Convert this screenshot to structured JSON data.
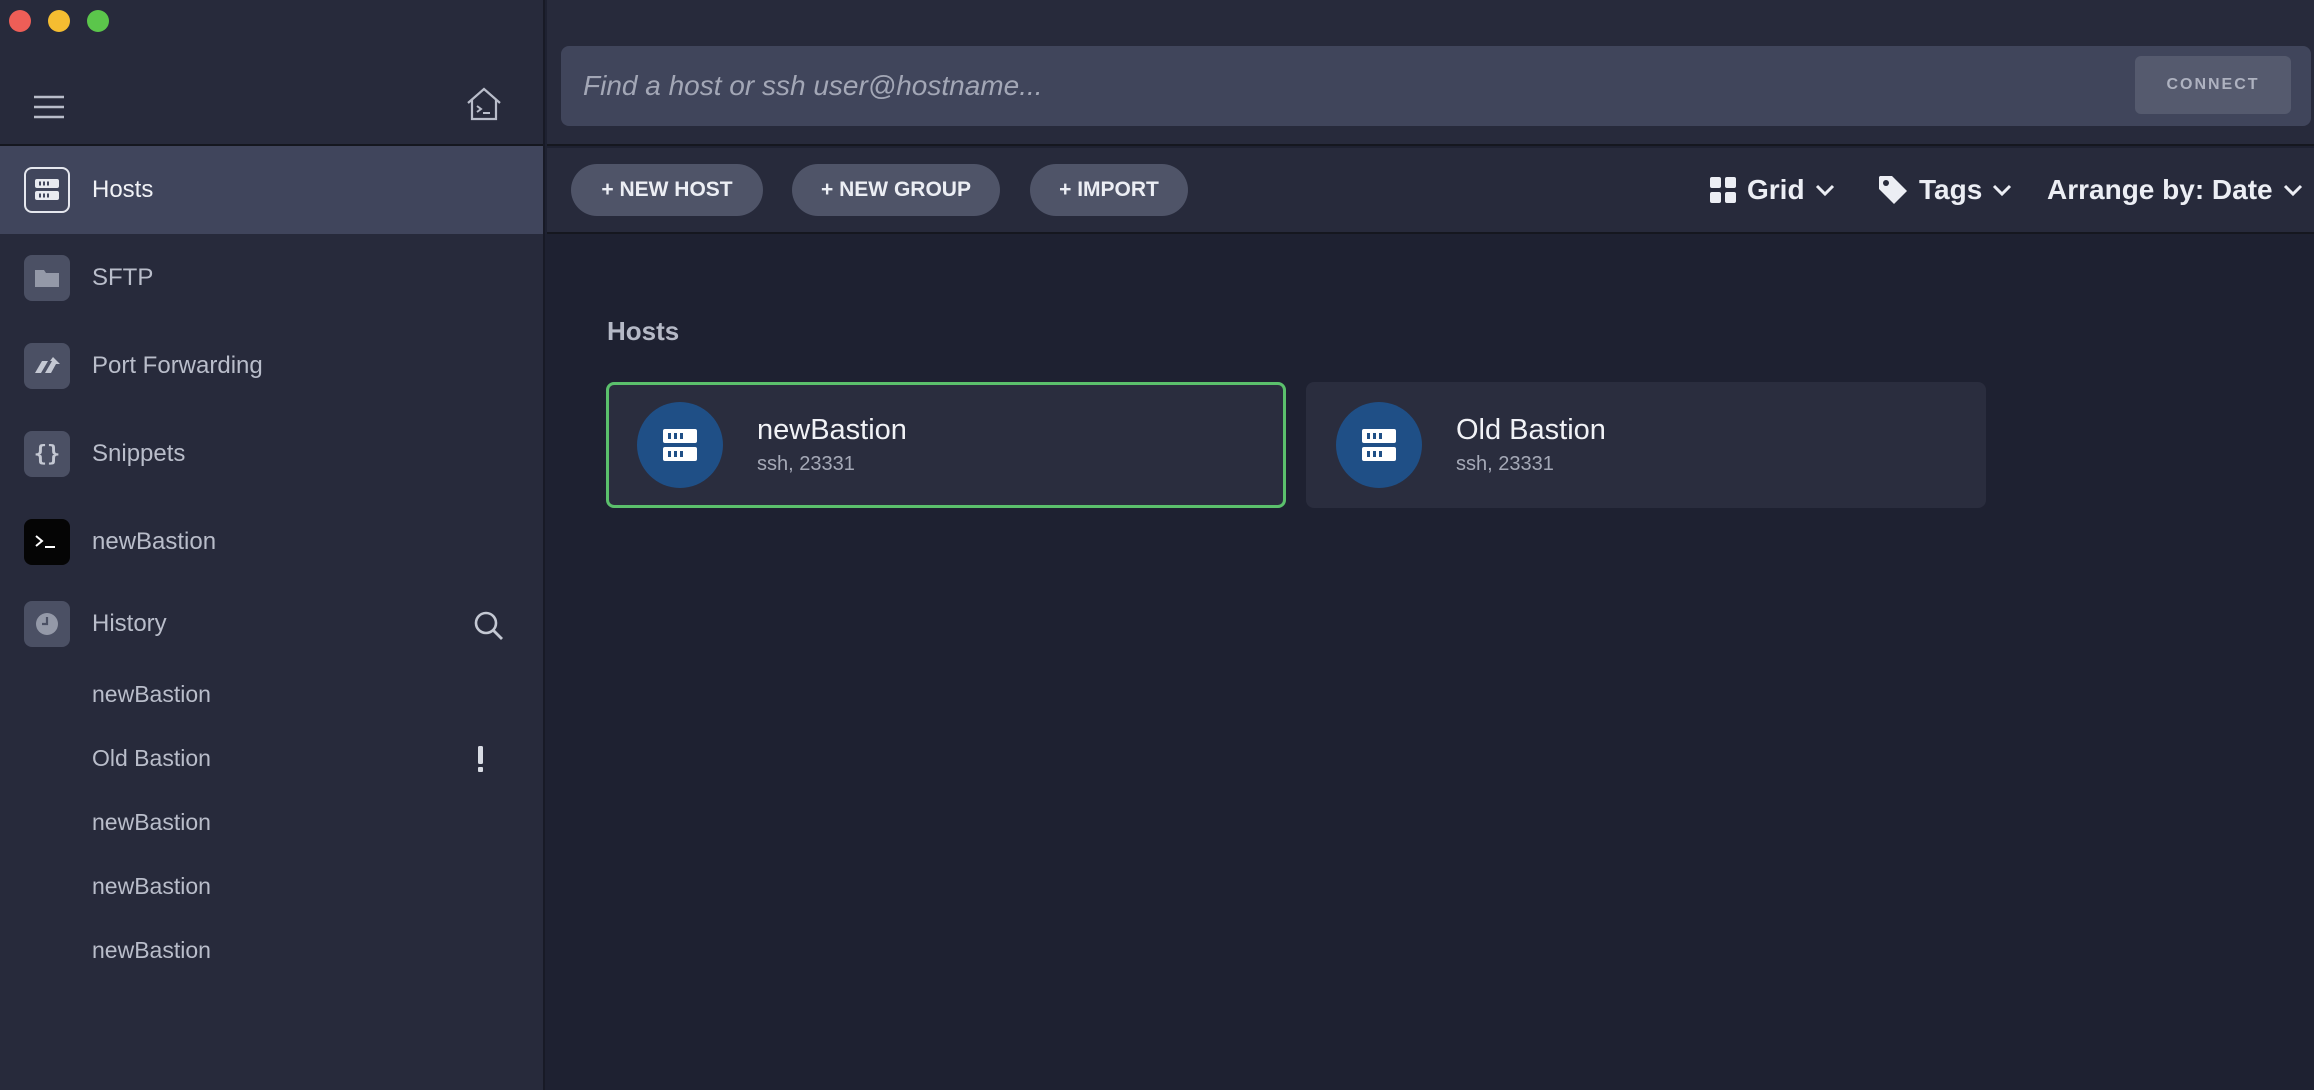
{
  "window": {
    "controls": [
      "close",
      "minimize",
      "maximize"
    ]
  },
  "sidebar": {
    "menu_icon": "hamburger-icon",
    "home_icon": "home-terminal-icon",
    "nav": [
      {
        "label": "Hosts",
        "icon": "server-icon",
        "active": true
      },
      {
        "label": "SFTP",
        "icon": "folder-icon",
        "active": false
      },
      {
        "label": "Port Forwarding",
        "icon": "port-forward-icon",
        "active": false
      },
      {
        "label": "Snippets",
        "icon": "braces-icon",
        "active": false
      },
      {
        "label": "newBastion",
        "icon": "terminal-icon",
        "active": false
      }
    ],
    "history": {
      "label": "History",
      "items": [
        {
          "label": "newBastion",
          "warning": false
        },
        {
          "label": "Old Bastion",
          "warning": true
        },
        {
          "label": "newBastion",
          "warning": false
        },
        {
          "label": "newBastion",
          "warning": false
        },
        {
          "label": "newBastion",
          "warning": false
        }
      ]
    }
  },
  "search": {
    "placeholder": "Find a host or ssh user@hostname...",
    "value": "",
    "connect_label": "CONNECT"
  },
  "toolbar": {
    "new_host": "+ NEW HOST",
    "new_group": "+ NEW GROUP",
    "import": "+ IMPORT",
    "view": "Grid",
    "tags": "Tags",
    "arrange": "Arrange by: Date"
  },
  "main": {
    "section_title": "Hosts",
    "hosts": [
      {
        "name": "newBastion",
        "details": "ssh, 23331",
        "selected": true
      },
      {
        "name": "Old Bastion",
        "details": "ssh, 23331",
        "selected": false
      }
    ]
  },
  "colors": {
    "sidebar_bg": "#272a3b",
    "main_bg": "#1e2131",
    "active_nav": "#40455c",
    "selected_border": "#5bc06c",
    "host_avatar": "#1f4f86"
  }
}
